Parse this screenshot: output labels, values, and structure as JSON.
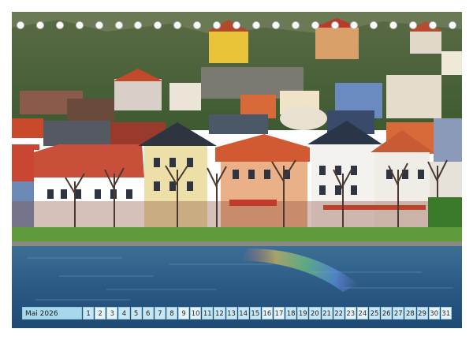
{
  "calendar": {
    "month_label": "Mai 2026",
    "days": [
      "1",
      "2",
      "3",
      "4",
      "5",
      "6",
      "7",
      "8",
      "9",
      "10",
      "11",
      "12",
      "13",
      "14",
      "15",
      "16",
      "17",
      "18",
      "19",
      "20",
      "21",
      "22",
      "23",
      "24",
      "25",
      "26",
      "27",
      "28",
      "29",
      "30",
      "31"
    ],
    "weekend_days": [
      "2",
      "3",
      "9",
      "10",
      "16",
      "17",
      "23",
      "24",
      "30",
      "31"
    ]
  },
  "colors": {
    "water": "#2d5c86",
    "grass": "#5f9a3d",
    "sky_hill": "#4d6b3a",
    "bar": "#c8e6f3"
  },
  "binding_hole_count": 23
}
